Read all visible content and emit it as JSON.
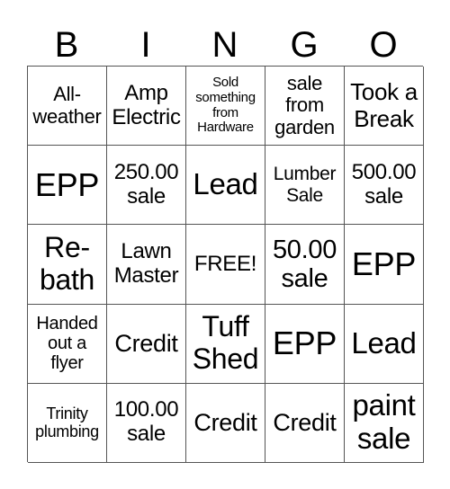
{
  "header": [
    "B",
    "I",
    "N",
    "G",
    "O"
  ],
  "cells": [
    "All-\nweather",
    "Amp\nElectric",
    "Sold\nsomething\nfrom\nHardware",
    "sale\nfrom\ngarden",
    "Took a\nBreak",
    "EPP",
    "250.00\nsale",
    "Lead",
    "Lumber\nSale",
    "500.00\nsale",
    "Re-\nbath",
    "Lawn\nMaster",
    "FREE!",
    "50.00\nsale",
    "EPP",
    "Handed\nout a\nflyer",
    "Credit",
    "Tuff\nShed",
    "EPP",
    "Lead",
    "Trinity\nplumbing",
    "100.00\nsale",
    "Credit",
    "Credit",
    "paint\nsale"
  ]
}
